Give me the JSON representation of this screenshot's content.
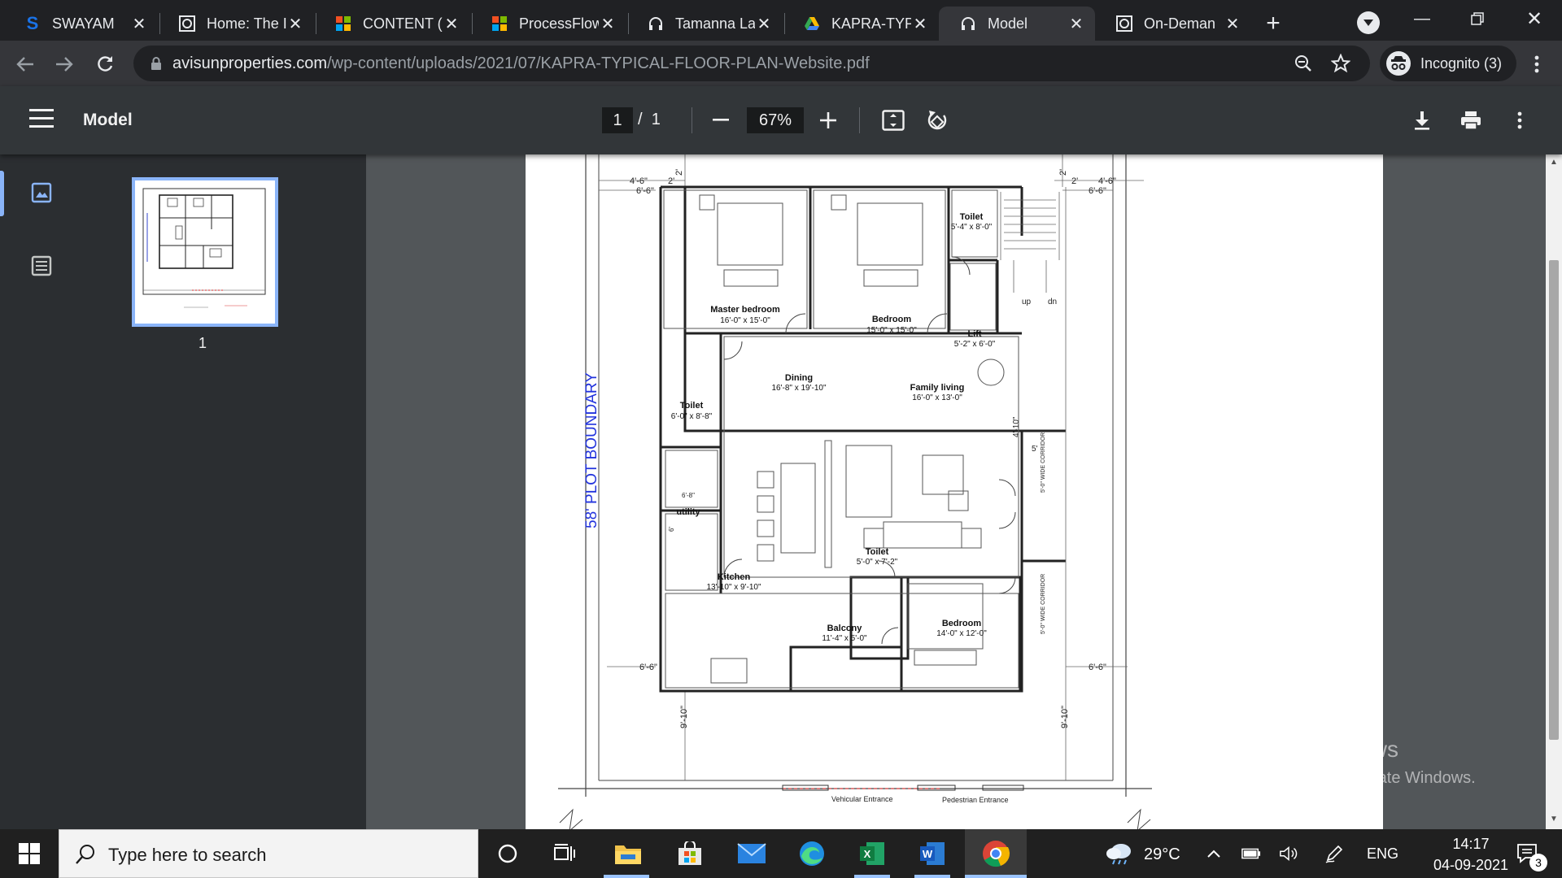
{
  "tabs": [
    {
      "label": "SWAYAM",
      "icon": "swayam-icon"
    },
    {
      "label": "Home: The I",
      "icon": "nptel-icon"
    },
    {
      "label": "CONTENT (",
      "icon": "microsoft-icon"
    },
    {
      "label": "ProcessFlow",
      "icon": "microsoft-icon"
    },
    {
      "label": "Tamanna La",
      "icon": "headphones-icon"
    },
    {
      "label": "KAPRA-TYP",
      "icon": "google-drive-icon"
    },
    {
      "label": "Model",
      "icon": "headphones-icon"
    },
    {
      "label": "On-Deman",
      "icon": "nptel-icon"
    }
  ],
  "browser": {
    "url_host": "avisunproperties.com",
    "url_path": "/wp-content/uploads/2021/07/KAPRA-TYPICAL-FLOOR-PLAN-Website.pdf",
    "incognito_label": "Incognito (3)",
    "accent": "#8ab4f8"
  },
  "pdf_viewer": {
    "title": "Model",
    "current_page": "1",
    "page_separator": "/",
    "total_pages": "1",
    "zoom": "67%",
    "thumbnail_page_label": "1"
  },
  "floorplan": {
    "plot_boundary": "58' PLOT BOUNDARY",
    "rooms": [
      {
        "name": "Master bedroom",
        "size": "16'-0\" x 15'-0\""
      },
      {
        "name": "Bedroom",
        "size": "15'-0\" x 15'-0\""
      },
      {
        "name": "Toilet",
        "size": "5'-4\" x 8'-0\""
      },
      {
        "name": "Lift",
        "size": "5'-2\" x 6'-0\""
      },
      {
        "name": "Dining",
        "size": "16'-8\" x 19'-10\""
      },
      {
        "name": "Family living",
        "size": "16'-0\" x 13'-0\""
      },
      {
        "name": "Toilet",
        "size": "6'-0\" x 8'-8\""
      },
      {
        "name": "utility",
        "size": ""
      },
      {
        "name": "Toilet",
        "size": "5'-0\" x 7'-2\""
      },
      {
        "name": "Kitchen",
        "size": "13'-10\" x 9'-10\""
      },
      {
        "name": "Balcony",
        "size": "11'-4\" x 5'-0\""
      },
      {
        "name": "Bedroom",
        "size": "14'-0\" x 12'-0\""
      }
    ],
    "dims": {
      "d45": "4'-6\"",
      "d65": "6'-6\"",
      "d2": "2'",
      "d910": "9'-10\"",
      "d410": "4'-10\"",
      "d5": "5'",
      "d68": "6'-8\"",
      "d6": "6'"
    },
    "labels": {
      "up": "up",
      "dn": "dn",
      "corridor": "5'-0\" WIDE CORRIDOR",
      "vehicular": "Vehicular Entrance",
      "pedestrian": "Pedestrian Entrance"
    }
  },
  "watermark": {
    "line1": "Activate Windows",
    "line2": "Go to Settings to activate Windows."
  },
  "taskbar": {
    "search_placeholder": "Type here to search",
    "weather": "29°C",
    "language": "ENG",
    "time": "14:17",
    "date": "04-09-2021",
    "notifications": "3"
  }
}
